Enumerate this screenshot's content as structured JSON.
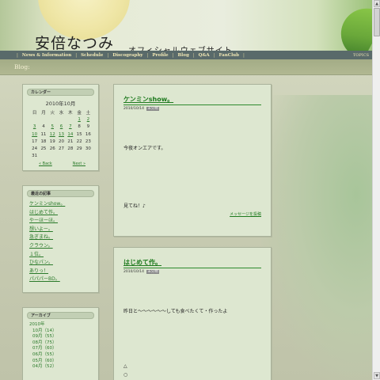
{
  "header": {
    "title": "安倍なつみ",
    "subtitle": "オフィシャルウェブサイト"
  },
  "nav": {
    "items": [
      "News & Information",
      "Schedule",
      "Discography",
      "Profile",
      "Blog",
      "Q&A",
      "FanClub"
    ],
    "topics": "TOPICS"
  },
  "section_label": "Blog:",
  "calendar": {
    "heading": "カレンダー",
    "month": "2010年10月",
    "weekdays": [
      "日",
      "月",
      "火",
      "水",
      "木",
      "金",
      "土"
    ],
    "rows": [
      [
        "",
        "",
        "",
        "",
        "",
        "1",
        "2"
      ],
      [
        "3",
        "4",
        "5",
        "6",
        "7",
        "8",
        "9"
      ],
      [
        "10",
        "11",
        "12",
        "13",
        "14",
        "15",
        "16"
      ],
      [
        "17",
        "18",
        "19",
        "20",
        "21",
        "22",
        "23"
      ],
      [
        "24",
        "25",
        "26",
        "27",
        "28",
        "29",
        "30"
      ],
      [
        "31",
        "",
        "",
        "",
        "",
        "",
        ""
      ]
    ],
    "linked_days": [
      "1",
      "2",
      "3",
      "5",
      "6",
      "7",
      "10",
      "12",
      "13",
      "14"
    ],
    "prev_label": "« Back",
    "next_label": "Next »"
  },
  "recent": {
    "heading": "最近の記事",
    "items": [
      "ケンミンshow。",
      "はじめて作。",
      "やーほーほ。",
      "想いよー。",
      "急ぎまね。",
      "クラウン。",
      "１位。",
      "ひなパン。",
      "ありっ！",
      "パパパーBD。"
    ]
  },
  "archive": {
    "heading": "アーカイブ",
    "year": "2010年",
    "months": [
      "10月（14）",
      "09月（55）",
      "08月（75）",
      "07月（60）",
      "06月（55）",
      "05月（60）",
      "04月（52）"
    ]
  },
  "posts": [
    {
      "title": "ケンミンshow。",
      "date": "2010/10/14",
      "category": "未分類",
      "lines": [
        "今夜オンエアです。",
        "見てね！♪"
      ],
      "more": "メッセージを投稿"
    },
    {
      "title": "はじめて作。",
      "date": "2010/10/14",
      "category": "未分類",
      "lines": [
        "昨日と～～～～～～しても食べたくて・作ったよ",
        "△",
        "○"
      ]
    }
  ]
}
